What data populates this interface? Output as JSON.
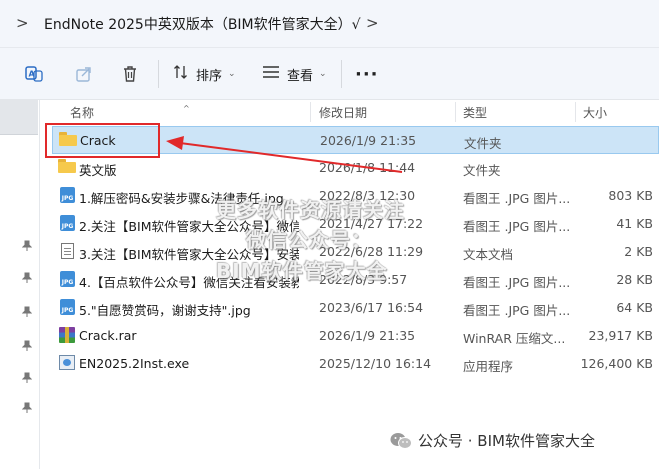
{
  "address": {
    "back_chevron": ">",
    "path": "EndNote 2025中英双版本（BIM软件管家大全）√",
    "next_chevron": ">"
  },
  "toolbar": {
    "sort_label": "排序",
    "view_label": "查看",
    "more_label": "···",
    "dropdown_glyph": "⌄"
  },
  "columns": {
    "name": "名称",
    "modified": "修改日期",
    "type": "类型",
    "size": "大小",
    "sort_caret": "^"
  },
  "files": [
    {
      "name": "Crack",
      "date": "2026/1/9 21:35",
      "type": "文件夹",
      "size": "",
      "icon": "folder",
      "selected": true
    },
    {
      "name": "英文版",
      "date": "2026/1/8 11:44",
      "type": "文件夹",
      "size": "",
      "icon": "folder",
      "selected": false
    },
    {
      "name": "1.解压密码&安装步骤&法律责任.jpg",
      "date": "2022/8/3 12:30",
      "type": "看图王 .JPG 图片...",
      "size": "803 KB",
      "icon": "jpg",
      "selected": false
    },
    {
      "name": "2.关注【BIM软件管家大全公众号】微信...",
      "date": "2021/4/27 17:22",
      "type": "看图王 .JPG 图片...",
      "size": "41 KB",
      "icon": "jpg",
      "selected": false
    },
    {
      "name": "3.关注【BIM软件管家大全公众号】安装...",
      "date": "2022/6/28 11:29",
      "type": "文本文档",
      "size": "2 KB",
      "icon": "txt",
      "selected": false
    },
    {
      "name": "4.【百点软件公众号】微信关注看安装教...",
      "date": "2022/8/3 9:57",
      "type": "看图王 .JPG 图片...",
      "size": "28 KB",
      "icon": "jpg",
      "selected": false
    },
    {
      "name": "5.\"自愿赞赏码，谢谢支持\".jpg",
      "date": "2023/6/17 16:54",
      "type": "看图王 .JPG 图片...",
      "size": "64 KB",
      "icon": "jpg",
      "selected": false
    },
    {
      "name": "Crack.rar",
      "date": "2026/1/9 21:35",
      "type": "WinRAR 压缩文...",
      "size": "23,917 KB",
      "icon": "rar",
      "selected": false
    },
    {
      "name": "EN2025.2Inst.exe",
      "date": "2025/12/10 16:14",
      "type": "应用程序",
      "size": "126,400 KB",
      "icon": "exe",
      "selected": false
    }
  ],
  "jpg_icon_text": "JPG",
  "watermarks": {
    "line1": "更多软件资源请关注",
    "line2": "微信公众号：",
    "line3": "BIM软件管家大全",
    "footer": "公众号 · BIM软件管家大全"
  },
  "colors": {
    "selection": "#cce4f7",
    "annotation_red": "#e1292a",
    "folder_yellow": "#f6c94c"
  }
}
